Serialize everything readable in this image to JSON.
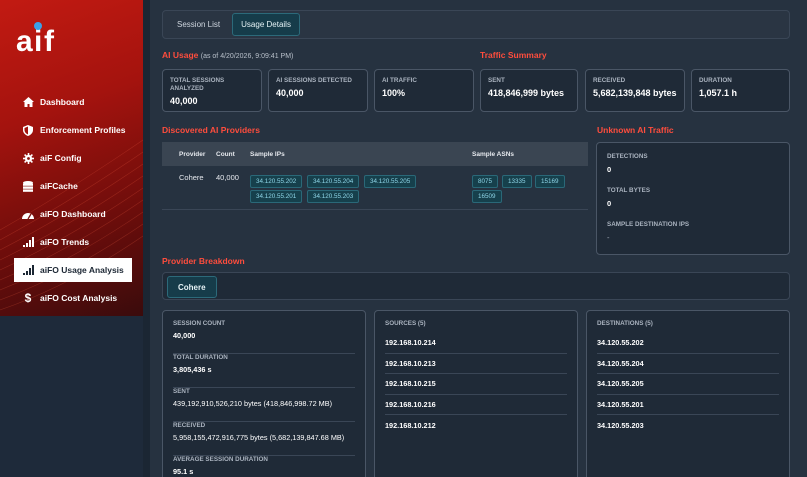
{
  "sidebar": {
    "logo_text": "aiF",
    "items": [
      {
        "label": "Dashboard",
        "icon": "home-icon"
      },
      {
        "label": "Enforcement Profiles",
        "icon": "shield-icon"
      },
      {
        "label": "aiF Config",
        "icon": "gear-icon"
      },
      {
        "label": "aiFCache",
        "icon": "database-icon"
      },
      {
        "label": "aiFO Dashboard",
        "icon": "gauge-icon"
      },
      {
        "label": "aiFO Trends",
        "icon": "signal-bars-icon"
      },
      {
        "label": "aiFO Usage Analysis",
        "icon": "signal-bars-icon"
      },
      {
        "label": "aiFO Cost Analysis",
        "icon": "dollar-icon"
      }
    ],
    "active_index": 6
  },
  "tabs": [
    "Session List",
    "Usage Details"
  ],
  "active_tab": "Usage Details",
  "ai_usage": {
    "title": "AI Usage",
    "asof": "(as of 4/20/2026, 9:09:41 PM)",
    "traffic_summary_title": "Traffic Summary",
    "stats": [
      {
        "label": "TOTAL SESSIONS ANALYZED",
        "value": "40,000"
      },
      {
        "label": "AI SESSIONS DETECTED",
        "value": "40,000"
      },
      {
        "label": "AI TRAFFIC",
        "value": "100%"
      },
      {
        "label": "SENT",
        "value": "418,846,999 bytes"
      },
      {
        "label": "RECEIVED",
        "value": "5,682,139,848 bytes"
      },
      {
        "label": "DURATION",
        "value": "1,057.1 h"
      }
    ]
  },
  "providers": {
    "title": "Discovered AI Providers",
    "headers": [
      "Provider",
      "Count",
      "Sample IPs",
      "Sample ASNs"
    ],
    "rows": [
      {
        "provider": "Cohere",
        "count": "40,000",
        "ips": [
          "34.120.55.202",
          "34.120.55.204",
          "34.120.55.205",
          "34.120.55.201",
          "34.120.55.203"
        ],
        "asns": [
          "8075",
          "13335",
          "15169",
          "16509"
        ]
      }
    ]
  },
  "unknown": {
    "title": "Unknown AI Traffic",
    "detections_label": "DETECTIONS",
    "detections": "0",
    "total_bytes_label": "TOTAL BYTES",
    "total_bytes": "0",
    "sample_dest_label": "SAMPLE DESTINATION IPS",
    "sample_dest": "-"
  },
  "breakdown": {
    "title": "Provider Breakdown",
    "selected": "Cohere",
    "details": [
      {
        "label": "SESSION COUNT",
        "value": "40,000"
      },
      {
        "label": "TOTAL DURATION",
        "value": "3,805,436 s"
      },
      {
        "label": "SENT",
        "value": "439,192,910,526,210 bytes (418,846,998.72 MB)"
      },
      {
        "label": "RECEIVED",
        "value": "5,958,155,472,916,775 bytes (5,682,139,847.68 MB)"
      },
      {
        "label": "AVERAGE SESSION DURATION",
        "value": "95.1 s"
      }
    ],
    "sources_title": "SOURCES (5)",
    "sources": [
      "192.168.10.214",
      "192.168.10.213",
      "192.168.10.215",
      "192.168.10.216",
      "192.168.10.212"
    ],
    "destinations_title": "DESTINATIONS (5)",
    "destinations": [
      "34.120.55.202",
      "34.120.55.204",
      "34.120.55.205",
      "34.120.55.201",
      "34.120.55.203"
    ]
  },
  "colors": {
    "accent_red": "#ff4d3d",
    "chip_teal": "#16404c",
    "chip_text": "#8fd6e8"
  }
}
